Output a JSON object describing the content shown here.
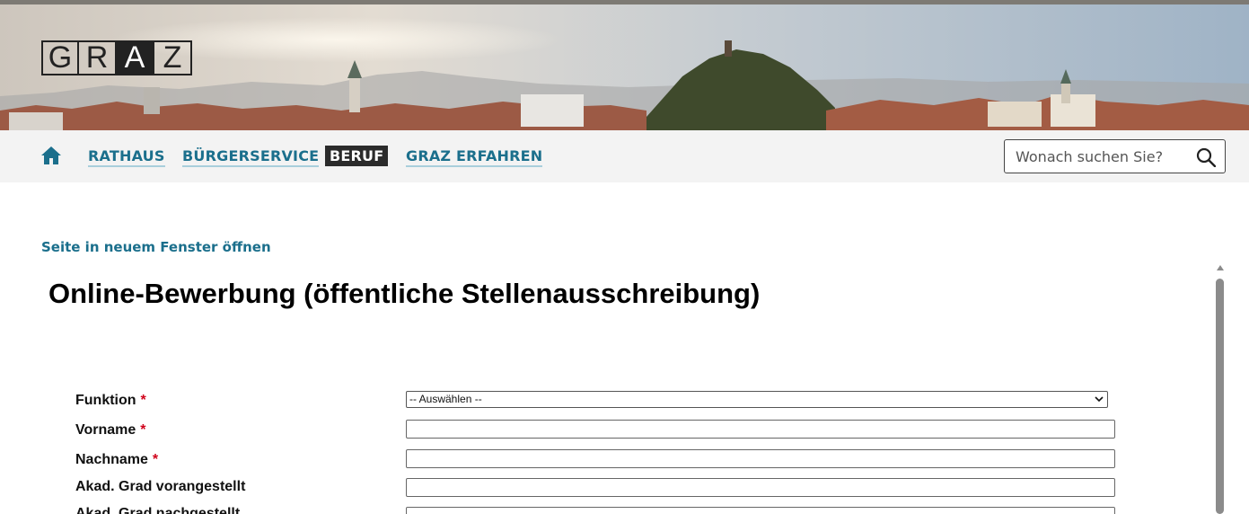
{
  "header": {
    "logo_letters": [
      "G",
      "R",
      "A",
      "Z"
    ],
    "logo_inverted_index": 2
  },
  "nav": {
    "home_icon": "home-icon",
    "items": [
      {
        "label": "RATHAUS",
        "active": false
      },
      {
        "label": "BÜRGERSERVICE",
        "active": false
      },
      {
        "label": "BERUF",
        "active": true
      },
      {
        "label": "GRAZ ERFAHREN",
        "active": false
      }
    ],
    "search": {
      "placeholder": "Wonach suchen Sie?",
      "value": "",
      "icon": "search-icon"
    }
  },
  "main": {
    "open_window_link": "Seite in neuem Fenster öffnen",
    "title": "Online-Bewerbung (öffentliche Stellenausschreibung)",
    "form": {
      "required_marker": "*",
      "fields": [
        {
          "label": "Funktion",
          "required": true,
          "type": "select",
          "value": "-- Auswählen --"
        },
        {
          "label": "Vorname",
          "required": true,
          "type": "text",
          "value": ""
        },
        {
          "label": "Nachname",
          "required": true,
          "type": "text",
          "value": ""
        },
        {
          "label": "Akad. Grad vorangestellt",
          "required": false,
          "type": "text",
          "value": ""
        },
        {
          "label": "Akad. Grad nachgestellt",
          "required": false,
          "type": "text",
          "value": ""
        }
      ]
    }
  },
  "colors": {
    "link": "#1b6f8c",
    "nav_background": "#f3f3f3",
    "active_nav_background": "#2b2b2b",
    "required": "#d0021b"
  }
}
